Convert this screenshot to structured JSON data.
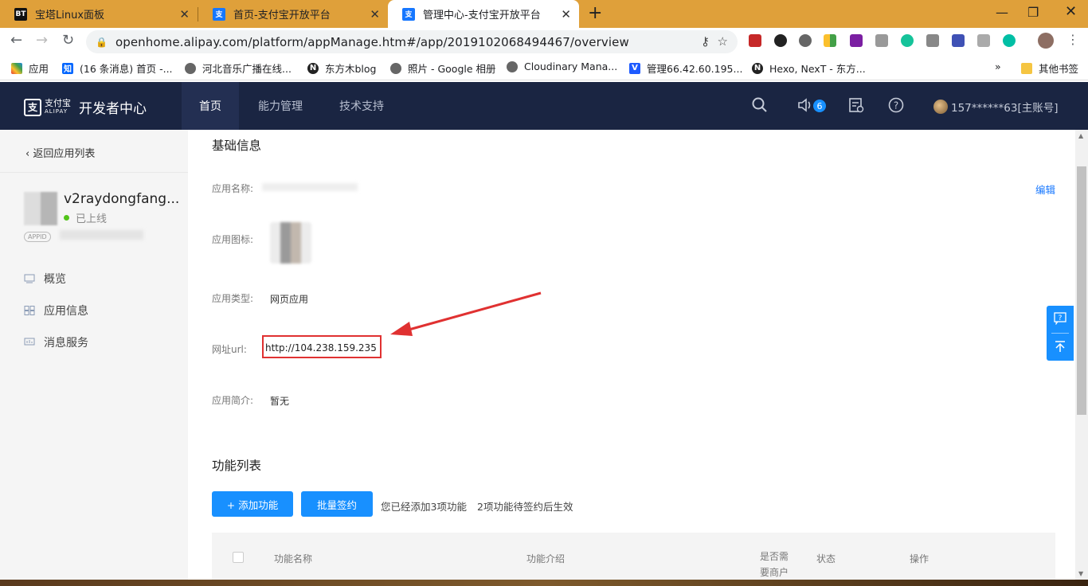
{
  "browser": {
    "tabs": [
      {
        "label": "宝塔Linux面板",
        "icon": "BT"
      },
      {
        "label": "首页-支付宝开放平台",
        "icon": "支"
      },
      {
        "label": "管理中心-支付宝开放平台",
        "icon": "支"
      }
    ],
    "url": "openhome.alipay.com/platform/appManage.htm#/app/2019102068494467/overview",
    "bookmarks": [
      "应用",
      "(16 条消息) 首页 -...",
      "河北音乐广播在线...",
      "东方木blog",
      "照片 - Google 相册",
      "Cloudinary Mana...",
      "管理66.42.60.195...",
      "Hexo, NexT - 东方...",
      "其他书签"
    ],
    "bookmark_more": "»"
  },
  "header": {
    "logo_main": "支付宝",
    "logo_sub": "ALIPAY",
    "title": "开发者中心",
    "nav": [
      "首页",
      "能力管理",
      "技术支持"
    ],
    "notification_count": "6",
    "account": "157******63[主账号]"
  },
  "sidebar": {
    "back": "返回应用列表",
    "app_name": "v2raydongfang...",
    "status": "已上线",
    "appid_tag": "APPID",
    "menu": [
      "概览",
      "应用信息",
      "消息服务"
    ]
  },
  "basic": {
    "title": "基础信息",
    "edit": "编辑",
    "fields": {
      "name_label": "应用名称:",
      "icon_label": "应用图标:",
      "type_label": "应用类型:",
      "type_value": "网页应用",
      "url_label": "网址url:",
      "url_value": "http://104.238.159.235",
      "intro_label": "应用简介:",
      "intro_value": "暂无"
    }
  },
  "features": {
    "title": "功能列表",
    "add_button": "+ 添加功能",
    "batch_button": "批量签约",
    "note1": "您已经添加3项功能",
    "note2": "2项功能待签约后生效",
    "columns": [
      "功能名称",
      "功能介绍",
      "是否需要商户",
      "状态",
      "操作"
    ]
  },
  "colors": {
    "accent": "#1890ff",
    "header_bg": "#1a2542",
    "highlight": "#e03131"
  }
}
